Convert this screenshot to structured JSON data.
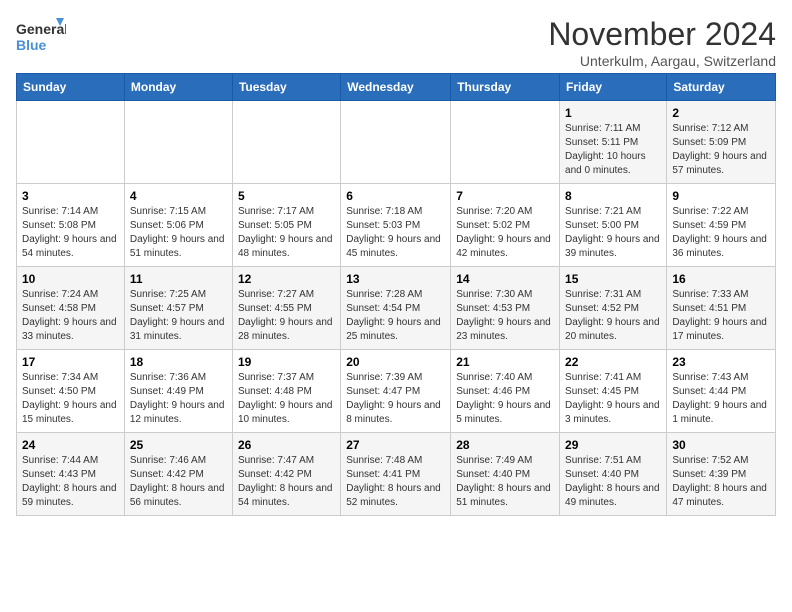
{
  "logo": {
    "line1": "General",
    "line2": "Blue"
  },
  "title": "November 2024",
  "subtitle": "Unterkulm, Aargau, Switzerland",
  "weekdays": [
    "Sunday",
    "Monday",
    "Tuesday",
    "Wednesday",
    "Thursday",
    "Friday",
    "Saturday"
  ],
  "weeks": [
    [
      {
        "day": "",
        "info": ""
      },
      {
        "day": "",
        "info": ""
      },
      {
        "day": "",
        "info": ""
      },
      {
        "day": "",
        "info": ""
      },
      {
        "day": "",
        "info": ""
      },
      {
        "day": "1",
        "info": "Sunrise: 7:11 AM\nSunset: 5:11 PM\nDaylight: 10 hours and 0 minutes."
      },
      {
        "day": "2",
        "info": "Sunrise: 7:12 AM\nSunset: 5:09 PM\nDaylight: 9 hours and 57 minutes."
      }
    ],
    [
      {
        "day": "3",
        "info": "Sunrise: 7:14 AM\nSunset: 5:08 PM\nDaylight: 9 hours and 54 minutes."
      },
      {
        "day": "4",
        "info": "Sunrise: 7:15 AM\nSunset: 5:06 PM\nDaylight: 9 hours and 51 minutes."
      },
      {
        "day": "5",
        "info": "Sunrise: 7:17 AM\nSunset: 5:05 PM\nDaylight: 9 hours and 48 minutes."
      },
      {
        "day": "6",
        "info": "Sunrise: 7:18 AM\nSunset: 5:03 PM\nDaylight: 9 hours and 45 minutes."
      },
      {
        "day": "7",
        "info": "Sunrise: 7:20 AM\nSunset: 5:02 PM\nDaylight: 9 hours and 42 minutes."
      },
      {
        "day": "8",
        "info": "Sunrise: 7:21 AM\nSunset: 5:00 PM\nDaylight: 9 hours and 39 minutes."
      },
      {
        "day": "9",
        "info": "Sunrise: 7:22 AM\nSunset: 4:59 PM\nDaylight: 9 hours and 36 minutes."
      }
    ],
    [
      {
        "day": "10",
        "info": "Sunrise: 7:24 AM\nSunset: 4:58 PM\nDaylight: 9 hours and 33 minutes."
      },
      {
        "day": "11",
        "info": "Sunrise: 7:25 AM\nSunset: 4:57 PM\nDaylight: 9 hours and 31 minutes."
      },
      {
        "day": "12",
        "info": "Sunrise: 7:27 AM\nSunset: 4:55 PM\nDaylight: 9 hours and 28 minutes."
      },
      {
        "day": "13",
        "info": "Sunrise: 7:28 AM\nSunset: 4:54 PM\nDaylight: 9 hours and 25 minutes."
      },
      {
        "day": "14",
        "info": "Sunrise: 7:30 AM\nSunset: 4:53 PM\nDaylight: 9 hours and 23 minutes."
      },
      {
        "day": "15",
        "info": "Sunrise: 7:31 AM\nSunset: 4:52 PM\nDaylight: 9 hours and 20 minutes."
      },
      {
        "day": "16",
        "info": "Sunrise: 7:33 AM\nSunset: 4:51 PM\nDaylight: 9 hours and 17 minutes."
      }
    ],
    [
      {
        "day": "17",
        "info": "Sunrise: 7:34 AM\nSunset: 4:50 PM\nDaylight: 9 hours and 15 minutes."
      },
      {
        "day": "18",
        "info": "Sunrise: 7:36 AM\nSunset: 4:49 PM\nDaylight: 9 hours and 12 minutes."
      },
      {
        "day": "19",
        "info": "Sunrise: 7:37 AM\nSunset: 4:48 PM\nDaylight: 9 hours and 10 minutes."
      },
      {
        "day": "20",
        "info": "Sunrise: 7:39 AM\nSunset: 4:47 PM\nDaylight: 9 hours and 8 minutes."
      },
      {
        "day": "21",
        "info": "Sunrise: 7:40 AM\nSunset: 4:46 PM\nDaylight: 9 hours and 5 minutes."
      },
      {
        "day": "22",
        "info": "Sunrise: 7:41 AM\nSunset: 4:45 PM\nDaylight: 9 hours and 3 minutes."
      },
      {
        "day": "23",
        "info": "Sunrise: 7:43 AM\nSunset: 4:44 PM\nDaylight: 9 hours and 1 minute."
      }
    ],
    [
      {
        "day": "24",
        "info": "Sunrise: 7:44 AM\nSunset: 4:43 PM\nDaylight: 8 hours and 59 minutes."
      },
      {
        "day": "25",
        "info": "Sunrise: 7:46 AM\nSunset: 4:42 PM\nDaylight: 8 hours and 56 minutes."
      },
      {
        "day": "26",
        "info": "Sunrise: 7:47 AM\nSunset: 4:42 PM\nDaylight: 8 hours and 54 minutes."
      },
      {
        "day": "27",
        "info": "Sunrise: 7:48 AM\nSunset: 4:41 PM\nDaylight: 8 hours and 52 minutes."
      },
      {
        "day": "28",
        "info": "Sunrise: 7:49 AM\nSunset: 4:40 PM\nDaylight: 8 hours and 51 minutes."
      },
      {
        "day": "29",
        "info": "Sunrise: 7:51 AM\nSunset: 4:40 PM\nDaylight: 8 hours and 49 minutes."
      },
      {
        "day": "30",
        "info": "Sunrise: 7:52 AM\nSunset: 4:39 PM\nDaylight: 8 hours and 47 minutes."
      }
    ]
  ]
}
